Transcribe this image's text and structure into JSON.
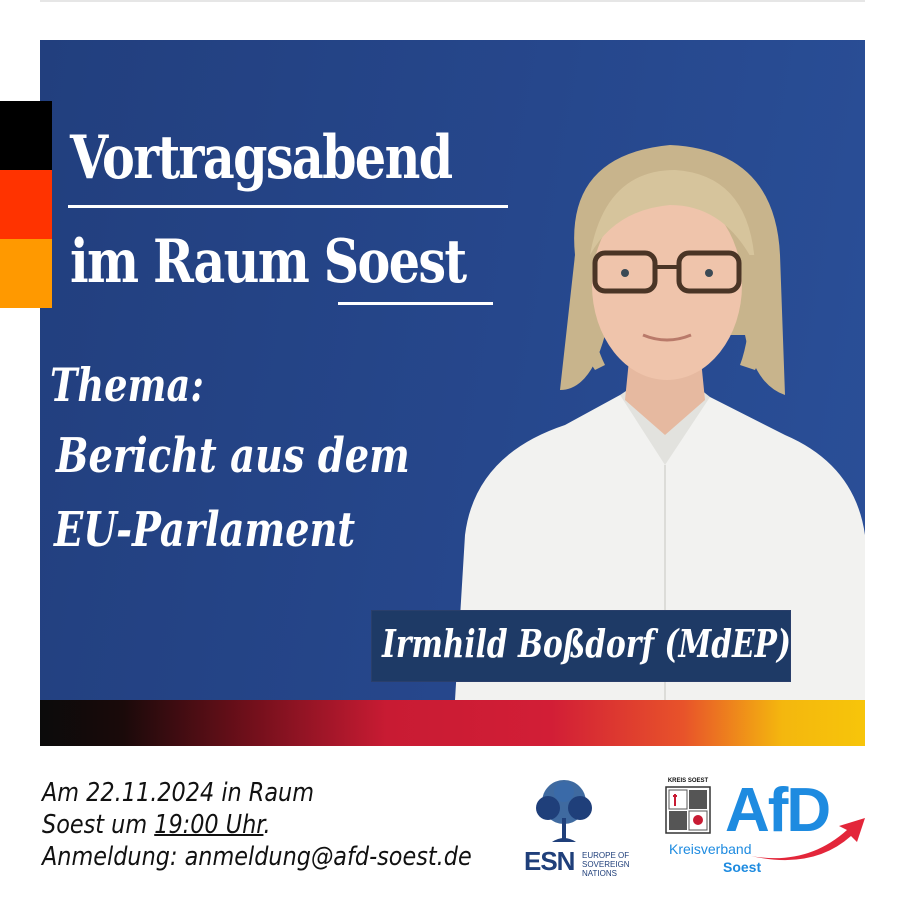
{
  "headline": {
    "word1": "Vortragsabend",
    "word2a": "im Raum",
    "word2b": "Soest"
  },
  "thema": {
    "label": "Thema:",
    "line1": "Bericht aus dem",
    "line2": "EU-Parlament"
  },
  "speaker": {
    "name": "Irmhild Boßdorf (MdEP)"
  },
  "footer": {
    "line1": "Am 22.11.2024 in Raum",
    "line2_pre": "Soest um ",
    "line2_time": "19:00 Uhr",
    "line2_post": ".",
    "line3": "Anmeldung: anmeldung@afd-soest.de"
  },
  "logos": {
    "esn_word": "ESN",
    "esn_sub1": "EUROPE OF",
    "esn_sub2": "SOVEREIGN",
    "esn_sub3": "NATIONS",
    "kreis_label": "KREIS SOEST",
    "afd_word": "AfD",
    "kreisverband": "Kreisverband",
    "soest": "Soest"
  },
  "colors": {
    "panel_blue": "#26478c",
    "flag_black": "#000000",
    "flag_red": "#ff3300",
    "flag_gold": "#ff9900",
    "afd_blue": "#1e8be0",
    "afd_red": "#e3263a",
    "esn_blue": "#1f3f7a"
  }
}
